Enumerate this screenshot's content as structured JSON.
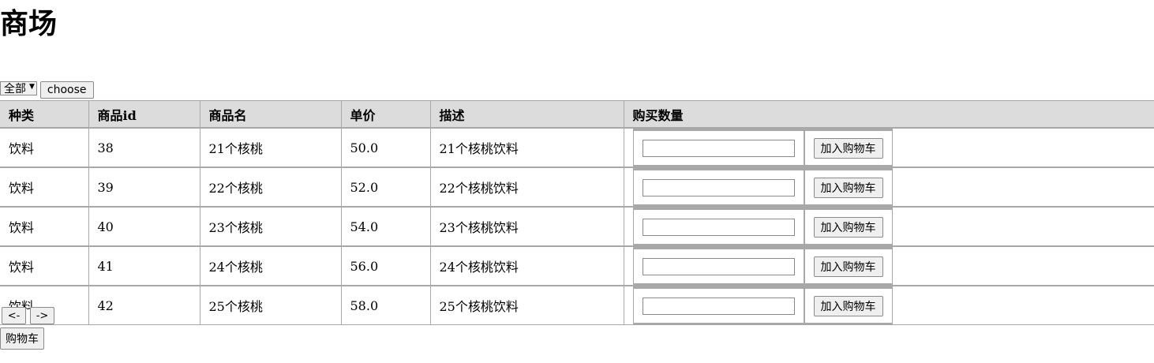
{
  "page": {
    "title": "商场"
  },
  "filter": {
    "selected": "全部",
    "choose_label": "choose"
  },
  "table": {
    "headers": [
      "种类",
      "商品id",
      "商品名",
      "单价",
      "描述",
      "购买数量"
    ],
    "add_label": "加入购物车",
    "rows": [
      {
        "category": "饮料",
        "id": "38",
        "name": "21个核桃",
        "price": "50.0",
        "desc": "21个核桃饮料",
        "qty": ""
      },
      {
        "category": "饮料",
        "id": "39",
        "name": "22个核桃",
        "price": "52.0",
        "desc": "22个核桃饮料",
        "qty": ""
      },
      {
        "category": "饮料",
        "id": "40",
        "name": "23个核桃",
        "price": "54.0",
        "desc": "23个核桃饮料",
        "qty": ""
      },
      {
        "category": "饮料",
        "id": "41",
        "name": "24个核桃",
        "price": "56.0",
        "desc": "24个核桃饮料",
        "qty": ""
      },
      {
        "category": "饮料",
        "id": "42",
        "name": "25个核桃",
        "price": "58.0",
        "desc": "25个核桃饮料",
        "qty": ""
      }
    ]
  },
  "pager": {
    "prev_label": "<-",
    "next_label": "->"
  },
  "cart": {
    "label": "购物车"
  }
}
